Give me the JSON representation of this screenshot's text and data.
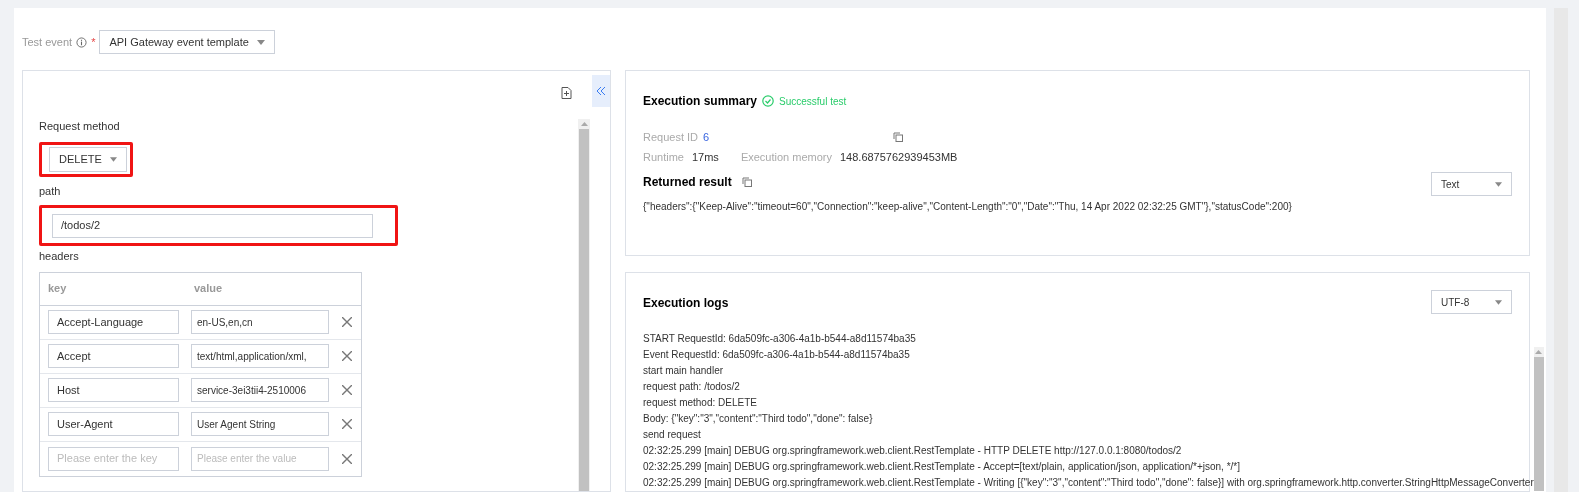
{
  "test_event": {
    "label": "Test event",
    "required_mark": "*",
    "value": "API Gateway event template"
  },
  "request": {
    "method_label": "Request method",
    "method": "DELETE",
    "method_highlighted": true,
    "path_label": "path",
    "path": "/todos/2",
    "path_highlighted": true,
    "headers_label": "headers",
    "columns": [
      "key",
      "value"
    ],
    "headers": [
      {
        "key": "Accept-Language",
        "value": "en-US,en,cn"
      },
      {
        "key": "Accept",
        "value": "text/html,application/xml,"
      },
      {
        "key": "Host",
        "value": "service-3ei3tii4-2510006"
      },
      {
        "key": "User-Agent",
        "value": "User Agent String"
      }
    ],
    "new_row": {
      "key_placeholder": "Please enter the key",
      "value_placeholder": "Please enter the value"
    }
  },
  "summary": {
    "title": "Execution summary",
    "status": "Successful test",
    "request_id_label": "Request ID",
    "request_id": "6",
    "runtime_label": "Runtime",
    "runtime": "17ms",
    "memory_label": "Execution memory",
    "memory": "148.6875762939453MB",
    "result_label": "Returned result",
    "format": "Text",
    "result": "{\"headers\":{\"Keep-Alive\":\"timeout=60\",\"Connection\":\"keep-alive\",\"Content-Length\":\"0\",\"Date\":\"Thu, 14 Apr 2022 02:32:25 GMT\"},\"statusCode\":200}"
  },
  "logs": {
    "title": "Execution logs",
    "encoding": "UTF-8",
    "lines": [
      "START RequestId: 6da509fc-a306-4a1b-b544-a8d11574ba35",
      "Event RequestId: 6da509fc-a306-4a1b-b544-a8d11574ba35",
      "start main handler",
      "request path: /todos/2",
      "request method: DELETE",
      "Body: {\"key\":\"3\",\"content\":\"Third todo\",\"done\": false}",
      "send request",
      "02:32:25.299 [main] DEBUG org.springframework.web.client.RestTemplate - HTTP DELETE http://127.0.0.1:8080/todos/2",
      "02:32:25.299 [main] DEBUG org.springframework.web.client.RestTemplate - Accept=[text/plain, application/json, application/*+json, */*]",
      "02:32:25.299 [main] DEBUG org.springframework.web.client.RestTemplate - Writing [{\"key\":\"3\",\"content\":\"Third todo\",\"done\": false}] with org.springframework.http.converter.StringHttpMessageConverter"
    ]
  }
}
